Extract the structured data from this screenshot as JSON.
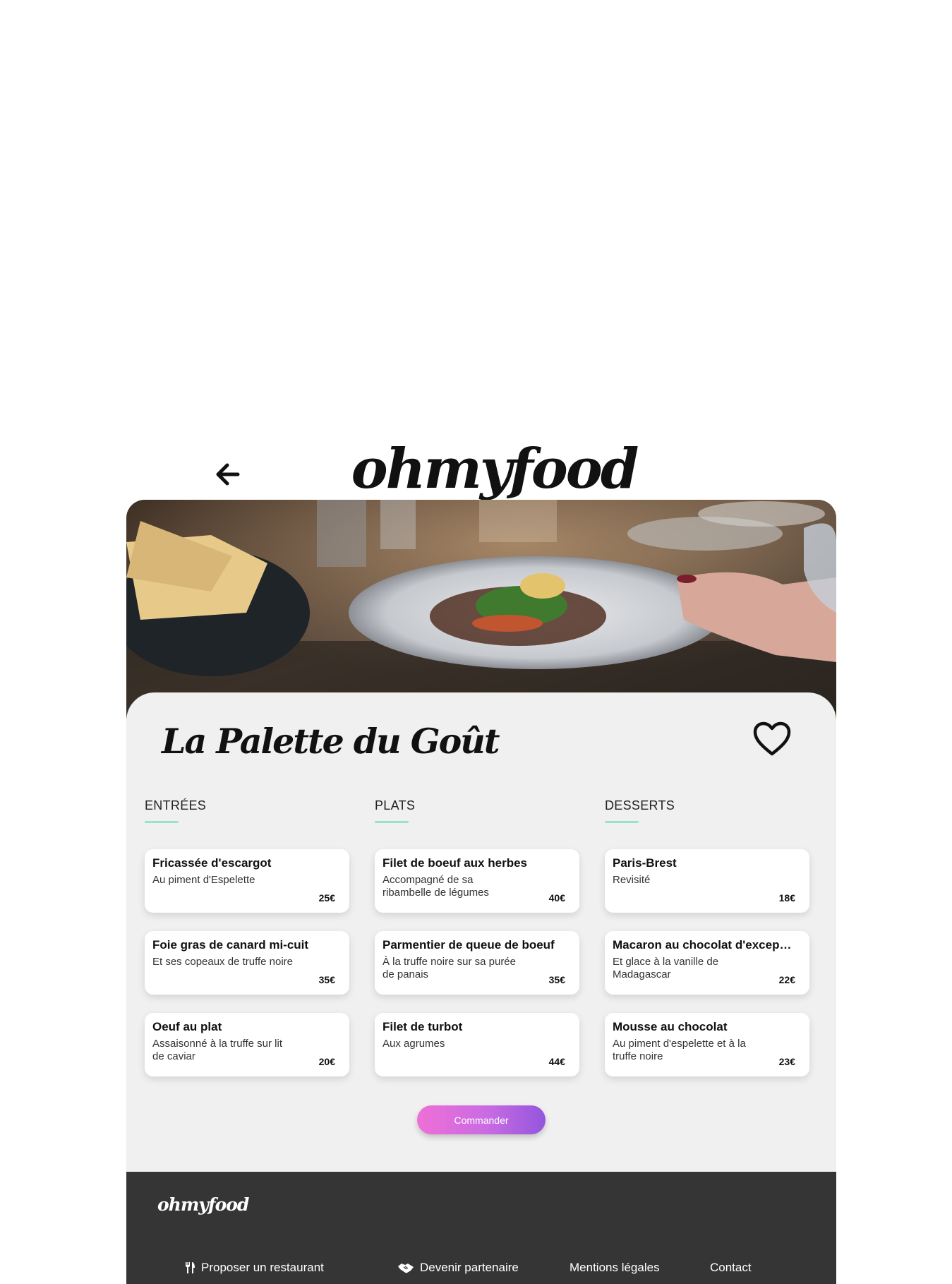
{
  "header": {
    "logo": "ohmyfood",
    "back_icon": "arrow-left-icon"
  },
  "restaurant": {
    "name": "La Palette du Goût",
    "favorite_icon": "heart-outline-icon"
  },
  "menu": {
    "columns": [
      {
        "heading": "ENTRÉES",
        "items": [
          {
            "name": "Fricassée d'escargot",
            "desc": "Au piment d'Espelette",
            "price": "25€"
          },
          {
            "name": "Foie gras de canard mi-cuit",
            "desc": "Et ses copeaux de truffe noire",
            "price": "35€"
          },
          {
            "name": "Oeuf au plat",
            "desc": "Assaisonné à la truffe sur lit de caviar",
            "price": "20€"
          }
        ]
      },
      {
        "heading": "PLATS",
        "items": [
          {
            "name": "Filet de boeuf aux herbes",
            "desc": "Accompagné de sa ribambelle de légumes",
            "price": "40€"
          },
          {
            "name": "Parmentier de queue de boeuf",
            "desc": "À la truffe noire sur sa purée de panais",
            "price": "35€"
          },
          {
            "name": "Filet de turbot",
            "desc": "Aux agrumes",
            "price": "44€"
          }
        ]
      },
      {
        "heading": "DESSERTS",
        "items": [
          {
            "name": "Paris-Brest",
            "desc": "Revisité",
            "price": "18€"
          },
          {
            "name": "Macaron au chocolat d'exception",
            "desc": "Et glace à la vanille de Madagascar",
            "price": "22€"
          },
          {
            "name": "Mousse au chocolat",
            "desc": "Au piment d'espelette et à la truffe noire",
            "price": "23€"
          }
        ]
      }
    ],
    "accent_color": "#99e2d0"
  },
  "order": {
    "label": "Commander",
    "gradient": [
      "#ef6fd6",
      "#9356dc"
    ]
  },
  "footer": {
    "logo": "ohmyfood",
    "links": [
      {
        "label": "Proposer un restaurant",
        "icon": "utensils-icon"
      },
      {
        "label": "Devenir partenaire",
        "icon": "handshake-icon"
      },
      {
        "label": "Mentions légales",
        "icon": ""
      },
      {
        "label": "Contact",
        "icon": ""
      }
    ],
    "background": "#353535"
  }
}
